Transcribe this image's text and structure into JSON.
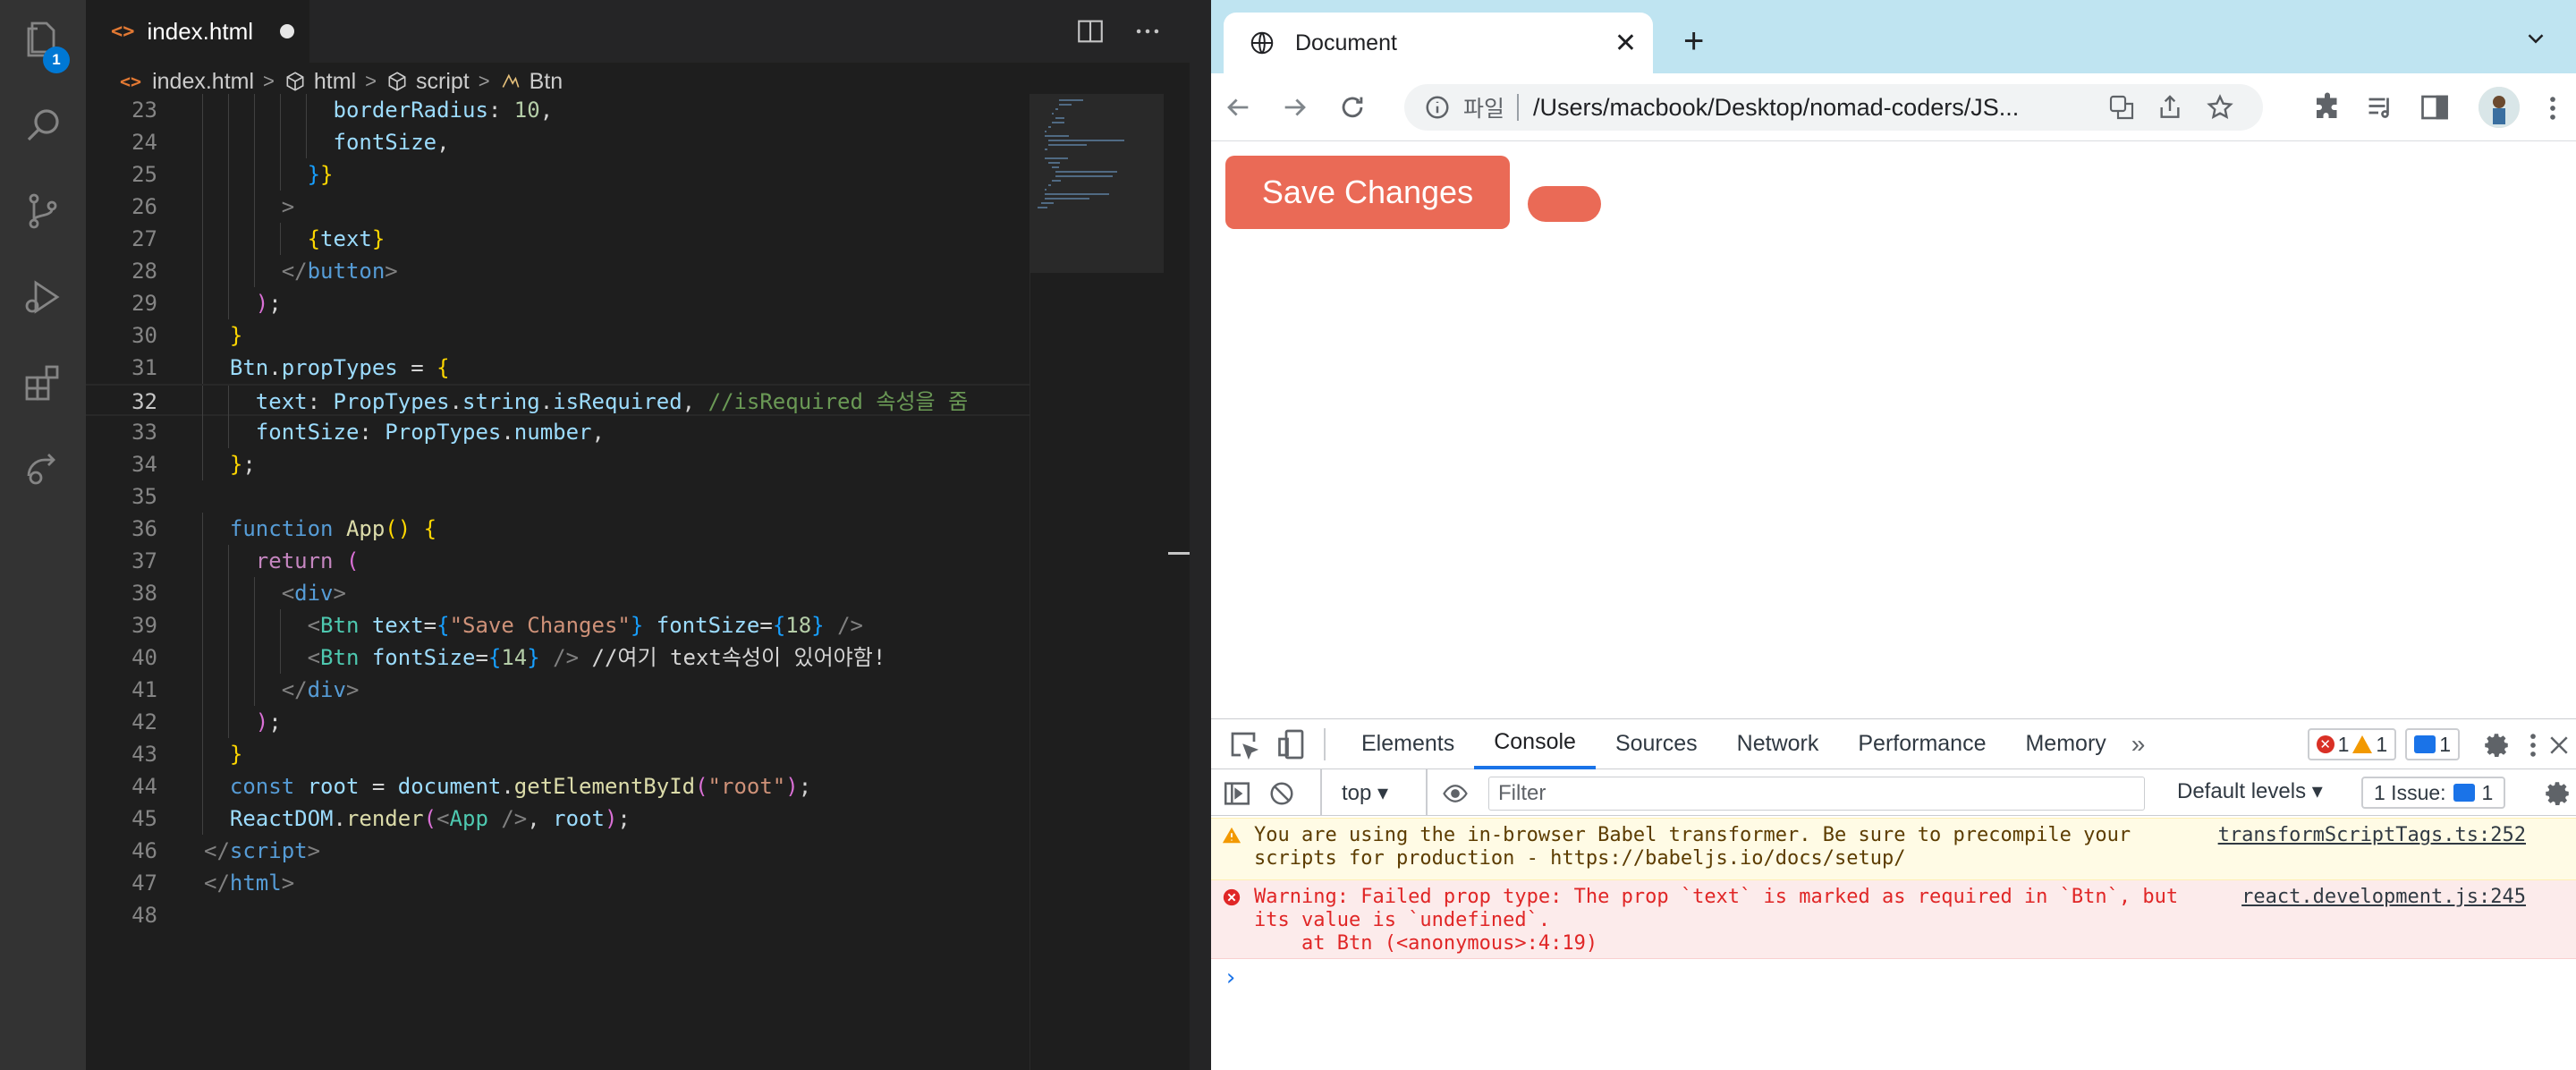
{
  "vscode": {
    "activity_badge": "1",
    "tab": {
      "label": "index.html"
    },
    "breadcrumb": [
      "index.html",
      "html",
      "script",
      "Btn"
    ],
    "lines": [
      {
        "n": "23",
        "indent": 6
      },
      {
        "n": "24",
        "indent": 6
      },
      {
        "n": "25",
        "indent": 5
      },
      {
        "n": "26",
        "indent": 4
      },
      {
        "n": "27",
        "indent": 5
      },
      {
        "n": "28",
        "indent": 4
      },
      {
        "n": "29",
        "indent": 3
      },
      {
        "n": "30",
        "indent": 2
      },
      {
        "n": "31",
        "indent": 2
      },
      {
        "n": "32",
        "indent": 3
      },
      {
        "n": "33",
        "indent": 3
      },
      {
        "n": "34",
        "indent": 2
      },
      {
        "n": "35",
        "indent": 0
      },
      {
        "n": "36",
        "indent": 2
      },
      {
        "n": "37",
        "indent": 3
      },
      {
        "n": "38",
        "indent": 4
      },
      {
        "n": "39",
        "indent": 5
      },
      {
        "n": "40",
        "indent": 5
      },
      {
        "n": "41",
        "indent": 4
      },
      {
        "n": "42",
        "indent": 3
      },
      {
        "n": "43",
        "indent": 2
      },
      {
        "n": "44",
        "indent": 2
      },
      {
        "n": "45",
        "indent": 2
      },
      {
        "n": "46",
        "indent": 1
      },
      {
        "n": "47",
        "indent": 0
      },
      {
        "n": "48",
        "indent": 0
      }
    ],
    "current_line": "32",
    "code_tokens": {
      "23": [
        [
          "v",
          "borderRadius"
        ],
        [
          "w",
          ": "
        ],
        [
          "n",
          "10"
        ],
        [
          "w",
          ","
        ]
      ],
      "24": [
        [
          "v",
          "fontSize"
        ],
        [
          "w",
          ","
        ]
      ],
      "25": [
        [
          "b3",
          "}"
        ],
        [
          "b1",
          "}"
        ]
      ],
      "26": [
        [
          "tg",
          ">"
        ]
      ],
      "27": [
        [
          "b1",
          "{"
        ],
        [
          "v",
          "text"
        ],
        [
          "b1",
          "}"
        ]
      ],
      "28": [
        [
          "tg",
          "</"
        ],
        [
          "ht",
          "button"
        ],
        [
          "tg",
          ">"
        ]
      ],
      "29": [
        [
          "b2",
          ")"
        ],
        [
          "w",
          ";"
        ]
      ],
      "30": [
        [
          "b1",
          "}"
        ]
      ],
      "31": [
        [
          "v",
          "Btn"
        ],
        [
          "w",
          "."
        ],
        [
          "v",
          "propTypes"
        ],
        [
          "w",
          " = "
        ],
        [
          "b1",
          "{"
        ]
      ],
      "32": [
        [
          "v",
          "text"
        ],
        [
          "w",
          ": "
        ],
        [
          "v",
          "PropTypes"
        ],
        [
          "w",
          "."
        ],
        [
          "v",
          "string"
        ],
        [
          "w",
          "."
        ],
        [
          "v",
          "isRequired"
        ],
        [
          "w",
          ", "
        ],
        [
          "c",
          "//isRequired 속성을 줌"
        ]
      ],
      "33": [
        [
          "v",
          "fontSize"
        ],
        [
          "w",
          ": "
        ],
        [
          "v",
          "PropTypes"
        ],
        [
          "w",
          "."
        ],
        [
          "v",
          "number"
        ],
        [
          "w",
          ","
        ]
      ],
      "34": [
        [
          "b1",
          "}"
        ],
        [
          "w",
          ";"
        ]
      ],
      "35": [],
      "36": [
        [
          "k",
          "function "
        ],
        [
          "f",
          "App"
        ],
        [
          "b1",
          "()"
        ],
        [
          "w",
          " "
        ],
        [
          "b1",
          "{"
        ]
      ],
      "37": [
        [
          "kc",
          "return "
        ],
        [
          "b2",
          "("
        ]
      ],
      "38": [
        [
          "tg",
          "<"
        ],
        [
          "ht",
          "div"
        ],
        [
          "tg",
          ">"
        ]
      ],
      "39": [
        [
          "tg",
          "<"
        ],
        [
          "t",
          "Btn"
        ],
        [
          "w",
          " "
        ],
        [
          "v",
          "text"
        ],
        [
          "w",
          "="
        ],
        [
          "b3",
          "{"
        ],
        [
          "s",
          "\"Save Changes\""
        ],
        [
          "b3",
          "}"
        ],
        [
          "w",
          " "
        ],
        [
          "v",
          "fontSize"
        ],
        [
          "w",
          "="
        ],
        [
          "b3",
          "{"
        ],
        [
          "n",
          "18"
        ],
        [
          "b3",
          "}"
        ],
        [
          "w",
          " "
        ],
        [
          "tg",
          "/>"
        ]
      ],
      "40": [
        [
          "tg",
          "<"
        ],
        [
          "t",
          "Btn"
        ],
        [
          "w",
          " "
        ],
        [
          "v",
          "fontSize"
        ],
        [
          "w",
          "="
        ],
        [
          "b3",
          "{"
        ],
        [
          "n",
          "14"
        ],
        [
          "b3",
          "}"
        ],
        [
          "w",
          " "
        ],
        [
          "tg",
          "/>"
        ],
        [
          "w",
          " //여기 text속성이 있어야함!"
        ]
      ],
      "41": [
        [
          "tg",
          "</"
        ],
        [
          "ht",
          "div"
        ],
        [
          "tg",
          ">"
        ]
      ],
      "42": [
        [
          "b2",
          ")"
        ],
        [
          "w",
          ";"
        ]
      ],
      "43": [
        [
          "b1",
          "}"
        ]
      ],
      "44": [
        [
          "k",
          "const "
        ],
        [
          "v",
          "root"
        ],
        [
          "w",
          " = "
        ],
        [
          "v",
          "document"
        ],
        [
          "w",
          "."
        ],
        [
          "f",
          "getElementById"
        ],
        [
          "b2",
          "("
        ],
        [
          "s",
          "\"root\""
        ],
        [
          "b2",
          ")"
        ],
        [
          "w",
          ";"
        ]
      ],
      "45": [
        [
          "v",
          "ReactDOM"
        ],
        [
          "w",
          "."
        ],
        [
          "f",
          "render"
        ],
        [
          "b2",
          "("
        ],
        [
          "tg",
          "<"
        ],
        [
          "t",
          "App"
        ],
        [
          "w",
          " "
        ],
        [
          "tg",
          "/>"
        ],
        [
          "w",
          ", "
        ],
        [
          "v",
          "root"
        ],
        [
          "b2",
          ")"
        ],
        [
          "w",
          ";"
        ]
      ],
      "46": [
        [
          "tg",
          "</"
        ],
        [
          "ht",
          "script"
        ],
        [
          "tg",
          ">"
        ]
      ],
      "47": [
        [
          "tg",
          "</"
        ],
        [
          "ht",
          "html"
        ],
        [
          "tg",
          ">"
        ]
      ],
      "48": []
    }
  },
  "chrome": {
    "tab_title": "Document",
    "url_scheme": "파일",
    "url": "/Users/macbook/Desktop/nomad-coders/JS...",
    "page": {
      "save_button_label": "Save Changes",
      "empty_button_label": ""
    },
    "devtools": {
      "tabs": [
        "Elements",
        "Console",
        "Sources",
        "Network",
        "Performance",
        "Memory"
      ],
      "active_tab": "Console",
      "counts": {
        "errors": "1",
        "warnings": "1",
        "info": "1"
      },
      "context": "top",
      "filter_placeholder": "Filter",
      "levels": "Default levels",
      "issues_label": "1 Issue:",
      "issues_count": "1",
      "messages": [
        {
          "level": "warning",
          "text": "You are using the in-browser Babel transformer. Be sure to precompile your\nscripts for production - https://babeljs.io/docs/setup/",
          "source": "transformScriptTags.ts:252"
        },
        {
          "level": "error",
          "text": "Warning: Failed prop type: The prop `text` is marked as required in `Btn`, but\nits value is `undefined`.\n    at Btn (<anonymous>:4:19)",
          "source": "react.development.js:245"
        }
      ]
    }
  },
  "colors": {
    "button_bg": "#ea6a56",
    "vscode_bg": "#1e1e1e",
    "chrome_tabstrip": "#bfe4f1"
  }
}
